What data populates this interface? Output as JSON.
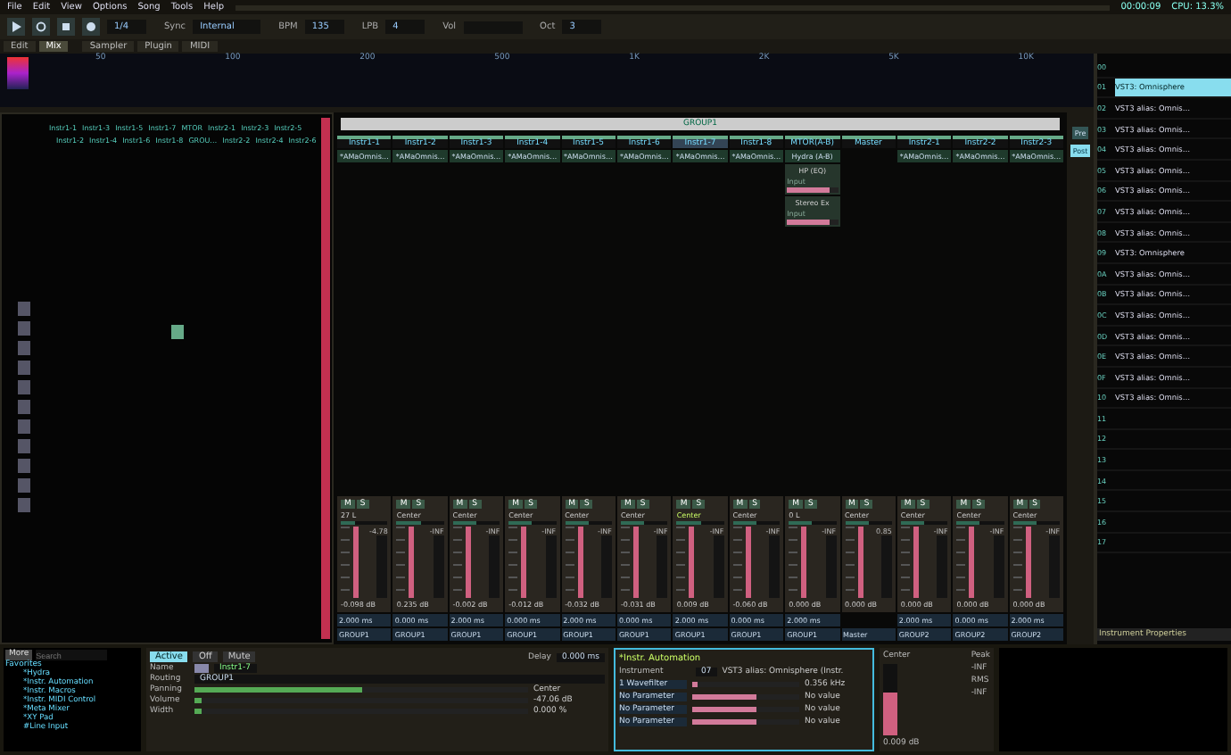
{
  "menu": [
    "File",
    "Edit",
    "View",
    "Options",
    "Song",
    "Tools",
    "Help"
  ],
  "status": {
    "time": "00:00:09",
    "cpu": "CPU: 13.3%"
  },
  "transport": {
    "step": "1/4",
    "sync_label": "Sync",
    "sync": "Internal",
    "bpm_label": "BPM",
    "bpm": "135",
    "lpb_label": "LPB",
    "lpb": "4",
    "vol_label": "Vol",
    "oct_label": "Oct",
    "oct": "3"
  },
  "view_tabs": [
    {
      "label": "Edit",
      "selected": false
    },
    {
      "label": "Mix",
      "selected": true
    }
  ],
  "lower_tabs": [
    {
      "label": "Sampler",
      "selected": false
    },
    {
      "label": "Plugin",
      "selected": false
    },
    {
      "label": "MIDI",
      "selected": false
    }
  ],
  "spectrum_labels": [
    "50",
    "100",
    "200",
    "500",
    "1K",
    "2K",
    "5K",
    "10K"
  ],
  "pattern": {
    "headers_top": [
      "Instr1-1",
      "Instr1-3",
      "Instr1-5",
      "Instr1-7",
      "MTOR",
      "Instr2-1",
      "Instr2-3",
      "Instr2-5"
    ],
    "headers_bottom": [
      "Instr1-2",
      "Instr1-4",
      "Instr1-6",
      "Instr1-8",
      "GROU…",
      "Instr2-2",
      "Instr2-4",
      "Instr2-6"
    ]
  },
  "mixer": {
    "group": "GROUP1",
    "pre": "Pre",
    "post": "Post",
    "channels": [
      {
        "name": "Instr1-1",
        "device": "*AMaOmnis…",
        "mute": "M",
        "solo": "S",
        "pan_slider": {
          "level": 0.3
        },
        "pan": "27 L",
        "peak": "-4.78",
        "volume": "-0.098 dB",
        "delay": "2.000 ms",
        "routing": "GROUP1",
        "selected": false
      },
      {
        "name": "Instr1-2",
        "device": "*AMaOmnis…",
        "mute": "M",
        "solo": "S",
        "pan_slider": {
          "level": 0.5
        },
        "pan": "Center",
        "peak": "-INF",
        "volume": "0.235 dB",
        "delay": "0.000 ms",
        "routing": "GROUP1",
        "selected": false
      },
      {
        "name": "Instr1-3",
        "device": "*AMaOmnis…",
        "mute": "M",
        "solo": "S",
        "pan_slider": {
          "level": 0.5
        },
        "pan": "Center",
        "peak": "-INF",
        "volume": "-0.002 dB",
        "delay": "2.000 ms",
        "routing": "GROUP1",
        "selected": false
      },
      {
        "name": "Instr1-4",
        "device": "*AMaOmnis…",
        "mute": "M",
        "solo": "S",
        "pan_slider": {
          "level": 0.5
        },
        "pan": "Center",
        "peak": "-INF",
        "volume": "-0.012 dB",
        "delay": "0.000 ms",
        "routing": "GROUP1",
        "selected": false
      },
      {
        "name": "Instr1-5",
        "device": "*AMaOmnis…",
        "mute": "M",
        "solo": "S",
        "pan_slider": {
          "level": 0.5
        },
        "pan": "Center",
        "peak": "-INF",
        "volume": "-0.032 dB",
        "delay": "2.000 ms",
        "routing": "GROUP1",
        "selected": false
      },
      {
        "name": "Instr1-6",
        "device": "*AMaOmnis…",
        "mute": "M",
        "solo": "S",
        "pan_slider": {
          "level": 0.5
        },
        "pan": "Center",
        "peak": "-INF",
        "volume": "-0.031 dB",
        "delay": "0.000 ms",
        "routing": "GROUP1",
        "selected": false
      },
      {
        "name": "Instr1-7",
        "device": "*AMaOmnis…",
        "mute": "M",
        "solo": "S",
        "pan_slider": {
          "level": 0.5
        },
        "pan": "Center",
        "peak": "-INF",
        "volume": "0.009 dB",
        "delay": "2.000 ms",
        "routing": "GROUP1",
        "selected": true
      },
      {
        "name": "Instr1-8",
        "device": "*AMaOmnis…",
        "mute": "M",
        "solo": "S",
        "pan_slider": {
          "level": 0.5
        },
        "pan": "Center",
        "peak": "-INF",
        "volume": "-0.060 dB",
        "delay": "0.000 ms",
        "routing": "GROUP1",
        "selected": false
      },
      {
        "name": "MTOR(A-B)",
        "device": "Hydra (A-B)",
        "mute": "M",
        "solo": "S",
        "pan_slider": {
          "level": 0.5
        },
        "pan": "0 L",
        "peak": "-INF",
        "volume": "0.000 dB",
        "delay": "2.000 ms",
        "routing": "GROUP1",
        "selected": false
      },
      {
        "name": "Master",
        "mute": "M",
        "solo": "S",
        "pan_slider": {
          "level": 0.5
        },
        "pan": "Center",
        "peak": "0.85",
        "volume": "0.000 dB",
        "routing": "Master",
        "selected": false
      },
      {
        "name": "Instr2-1",
        "device": "*AMaOmnis…",
        "mute": "M",
        "solo": "S",
        "pan_slider": {
          "level": 0.5
        },
        "pan": "Center",
        "peak": "-INF",
        "volume": "0.000 dB",
        "delay": "2.000 ms",
        "routing": "GROUP2",
        "selected": false
      },
      {
        "name": "Instr2-2",
        "device": "*AMaOmnis…",
        "mute": "M",
        "solo": "S",
        "pan_slider": {
          "level": 0.5
        },
        "pan": "Center",
        "peak": "-INF",
        "volume": "0.000 dB",
        "delay": "0.000 ms",
        "routing": "GROUP2",
        "selected": false
      },
      {
        "name": "Instr2-3",
        "device": "*AMaOmnis…",
        "mute": "M",
        "solo": "S",
        "pan_slider": {
          "level": 0.5
        },
        "pan": "Center",
        "peak": "-INF",
        "volume": "0.000 dB",
        "delay": "2.000 ms",
        "routing": "GROUP2",
        "selected": false
      }
    ],
    "extra_devices": [
      {
        "name": "HP (EQ)",
        "label": "Input",
        "level": 0.85
      },
      {
        "name": "Stereo Ex",
        "label": "Input",
        "level": 0.85
      }
    ]
  },
  "dsp_browser": {
    "more": "More",
    "search_placeholder": "Search",
    "root": "Favorites",
    "items": [
      "*Hydra",
      "*Instr. Automation",
      "*Instr. Macros",
      "*Instr. MIDI Control",
      "*Meta Mixer",
      "*XY Pad",
      "#Line Input"
    ]
  },
  "track": {
    "buttons": [
      {
        "label": "Active",
        "selected": true
      },
      {
        "label": "Off",
        "selected": false
      },
      {
        "label": "Mute",
        "selected": false
      }
    ],
    "delay_label": "Delay",
    "delay": "0.000 ms",
    "name_label": "Name",
    "name": "Instr1-7",
    "routing_label": "Routing",
    "routing": "GROUP1",
    "rows": [
      {
        "label": "Panning",
        "value": "Center",
        "level": 0.5
      },
      {
        "label": "Volume",
        "value": "-47.06 dB",
        "level": 0.02
      },
      {
        "label": "Width",
        "value": "0.000 %",
        "level": 0.02
      }
    ]
  },
  "automation": {
    "title": "*Instr. Automation",
    "instrument_label": "Instrument",
    "instrument_index": "07",
    "instrument": "VST3 alias: Omnisphere (Instr.",
    "params": [
      {
        "name": "1 Wavefilter",
        "value": "0.356 kHz",
        "level": 0.05
      },
      {
        "name": "No Parameter",
        "value": "No value",
        "level": 0.6
      },
      {
        "name": "No Parameter",
        "value": "No value",
        "level": 0.6
      },
      {
        "name": "No Parameter",
        "value": "No value",
        "level": 0.6
      }
    ]
  },
  "meter": {
    "pan": "Center",
    "volume": "0.009 dB",
    "peak_label": "Peak",
    "peak": "-INF",
    "rms_label": "RMS",
    "rms": "-INF"
  },
  "instruments": {
    "items": [
      {
        "index": "00",
        "selected": false
      },
      {
        "index": "01",
        "name": "VST3: Omnisphere",
        "selected": true
      },
      {
        "index": "02",
        "name": "VST3 alias: Omnis…",
        "selected": false
      },
      {
        "index": "03",
        "name": "VST3 alias: Omnis…",
        "selected": false
      },
      {
        "index": "04",
        "name": "VST3 alias: Omnis…",
        "selected": false
      },
      {
        "index": "05",
        "name": "VST3 alias: Omnis…",
        "selected": false
      },
      {
        "index": "06",
        "name": "VST3 alias: Omnis…",
        "selected": false
      },
      {
        "index": "07",
        "name": "VST3 alias: Omnis…",
        "selected": false
      },
      {
        "index": "08",
        "name": "VST3 alias: Omnis…",
        "selected": false
      },
      {
        "index": "09",
        "name": "VST3: Omnisphere",
        "selected": false
      },
      {
        "index": "0A",
        "name": "VST3 alias: Omnis…",
        "selected": false
      },
      {
        "index": "0B",
        "name": "VST3 alias: Omnis…",
        "selected": false
      },
      {
        "index": "0C",
        "name": "VST3 alias: Omnis…",
        "selected": false
      },
      {
        "index": "0D",
        "name": "VST3 alias: Omnis…",
        "selected": false
      },
      {
        "index": "0E",
        "name": "VST3 alias: Omnis…",
        "selected": false
      },
      {
        "index": "0F",
        "name": "VST3 alias: Omnis…",
        "selected": false
      },
      {
        "index": "10",
        "name": "VST3 alias: Omnis…",
        "selected": false
      },
      {
        "index": "11",
        "selected": false
      },
      {
        "index": "12",
        "selected": false
      },
      {
        "index": "13",
        "selected": false
      },
      {
        "index": "14",
        "selected": false
      },
      {
        "index": "15",
        "selected": false
      },
      {
        "index": "16",
        "selected": false
      },
      {
        "index": "17",
        "selected": false
      }
    ],
    "properties": "Instrument Properties"
  }
}
